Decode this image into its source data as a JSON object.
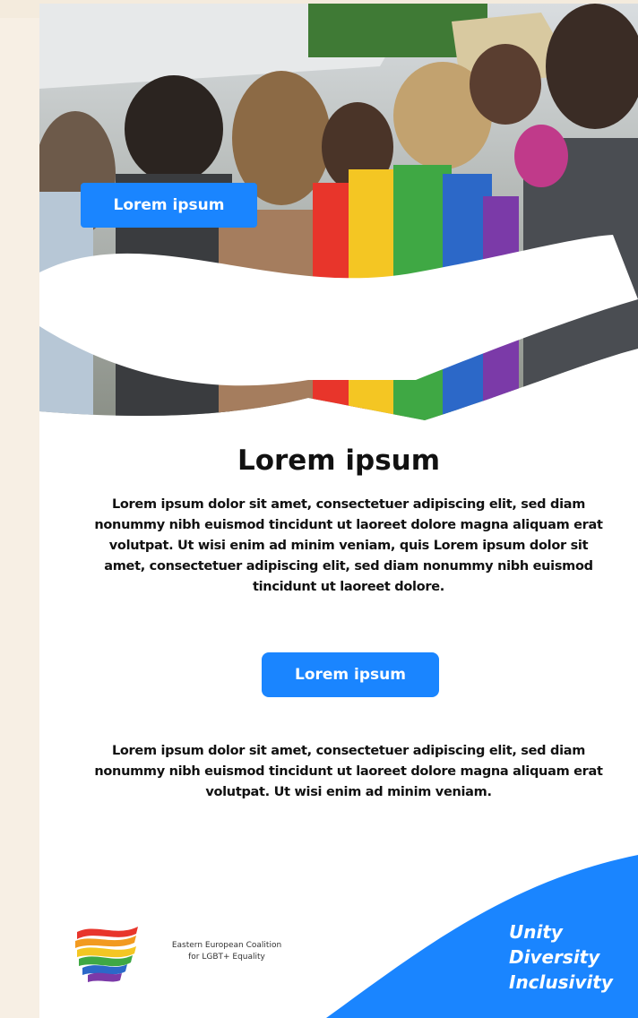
{
  "hero": {
    "button_label": "Lorem ipsum"
  },
  "content": {
    "headline": "Lorem ipsum",
    "paragraph_1": "Lorem ipsum dolor sit amet, consectetuer adipiscing elit, sed diam nonummy nibh euismod tincidunt ut laoreet dolore magna aliquam erat volutpat. Ut wisi enim ad minim veniam, quis Lorem ipsum dolor sit amet, consectetuer adipiscing elit, sed diam nonummy nibh euismod tincidunt ut laoreet dolore.",
    "cta_label": "Lorem ipsum",
    "paragraph_2": "Lorem ipsum dolor sit amet, consectetuer adipiscing elit, sed diam nonummy nibh euismod tincidunt ut laoreet dolore magna aliquam erat volutpat. Ut wisi enim ad minim veniam."
  },
  "footer": {
    "org_line_1": "Eastern European Coalition",
    "org_line_2": "for LGBT+ Equality",
    "tagline": [
      "Unity",
      "Diversity",
      "Inclusivity"
    ]
  },
  "colors": {
    "accent": "#1a85ff",
    "page_background": "#f4ebdd",
    "card_background": "#ffffff",
    "text": "#111111"
  },
  "icons": {
    "logo": "rainbow-ribbon-logo"
  }
}
